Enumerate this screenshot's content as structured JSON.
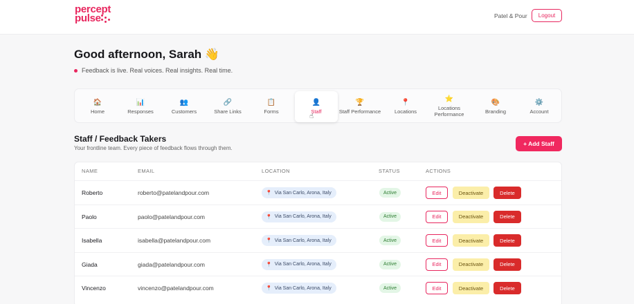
{
  "header": {
    "logo_line1": "percept",
    "logo_line2": "pulse",
    "account_name": "Patel & Pour",
    "logout_label": "Logout"
  },
  "greeting": {
    "text": "Good afternoon, Sarah 👋",
    "live_text": "Feedback is live. Real voices. Real insights. Real time."
  },
  "nav": {
    "items": [
      {
        "label": "Home",
        "icon": "🏠",
        "icon_name": "home-icon"
      },
      {
        "label": "Responses",
        "icon": "📊",
        "icon_name": "bar-chart-icon"
      },
      {
        "label": "Customers",
        "icon": "👥",
        "icon_name": "people-icon"
      },
      {
        "label": "Share Links",
        "icon": "🔗",
        "icon_name": "link-icon"
      },
      {
        "label": "Forms",
        "icon": "📋",
        "icon_name": "clipboard-icon"
      },
      {
        "label": "Staff",
        "icon": "👤",
        "icon_name": "person-icon"
      },
      {
        "label": "Staff Performance",
        "icon": "🏆",
        "icon_name": "trophy-icon"
      },
      {
        "label": "Locations",
        "icon": "📍",
        "icon_name": "pin-icon"
      },
      {
        "label": "Locations Performance",
        "icon": "⭐",
        "icon_name": "star-icon"
      },
      {
        "label": "Branding",
        "icon": "🎨",
        "icon_name": "palette-icon"
      },
      {
        "label": "Account",
        "icon": "⚙️",
        "icon_name": "gear-icon"
      }
    ],
    "active": "Staff"
  },
  "section": {
    "title": "Staff / Feedback Takers",
    "subtitle": "Your frontline team. Every piece of feedback flows through them.",
    "add_label": "+ Add Staff"
  },
  "table": {
    "columns": [
      "NAME",
      "EMAIL",
      "LOCATION",
      "STATUS",
      "ACTIONS"
    ],
    "rows": [
      {
        "name": "Roberto",
        "email": "roberto@patelandpour.com",
        "location": "Via San Carlo, Arona, Italy",
        "status": "Active"
      },
      {
        "name": "Paolo",
        "email": "paolo@patelandpour.com",
        "location": "Via San Carlo, Arona, Italy",
        "status": "Active"
      },
      {
        "name": "Isabella",
        "email": "isabella@patelandpour.com",
        "location": "Via San Carlo, Arona, Italy",
        "status": "Active"
      },
      {
        "name": "Giada",
        "email": "giada@patelandpour.com",
        "location": "Via San Carlo, Arona, Italy",
        "status": "Active"
      },
      {
        "name": "Vincenzo",
        "email": "vincenzo@patelandpour.com",
        "location": "Via San Carlo, Arona, Italy",
        "status": "Active"
      }
    ],
    "actions": {
      "edit": "Edit",
      "deactivate": "Deactivate",
      "delete": "Delete"
    }
  },
  "colors": {
    "brand": "#e8265e",
    "delete": "#d92b2b",
    "deactivate_bg": "#fbeea9",
    "status_bg": "#e3f6e6",
    "location_bg": "#e5eefb"
  }
}
